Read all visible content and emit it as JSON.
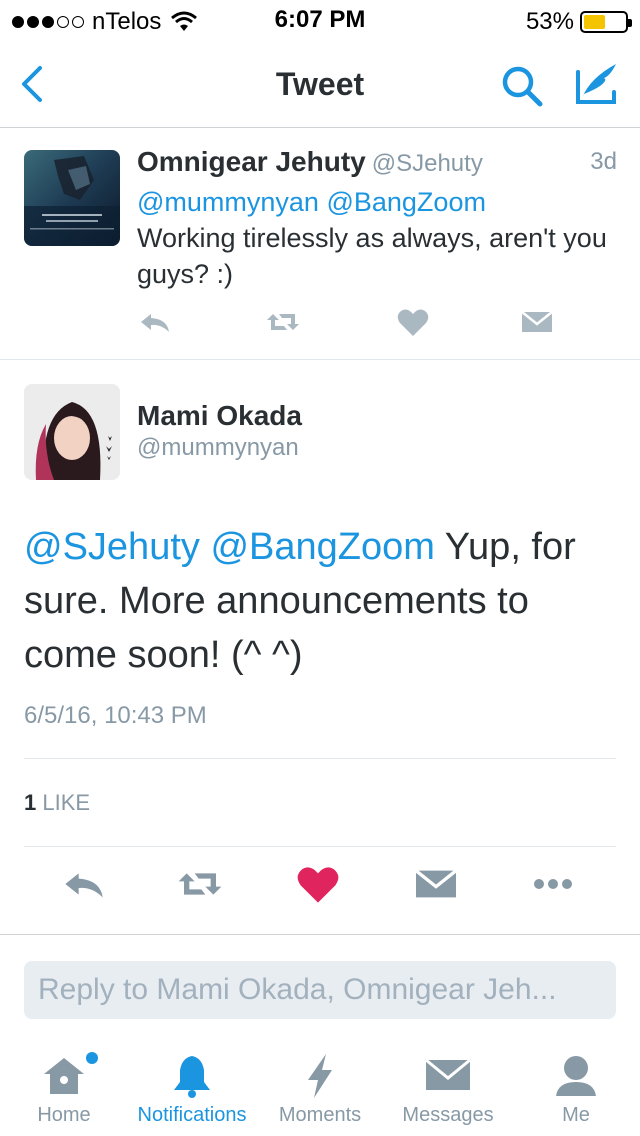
{
  "status_bar": {
    "carrier": "nTelos",
    "time": "6:07 PM",
    "battery": "53%",
    "battery_level": 0.53
  },
  "nav": {
    "title": "Tweet"
  },
  "parent_tweet": {
    "name": "Omnigear Jehuty",
    "handle": "@SJehuty",
    "time": "3d",
    "mention_1": "@mummynyan",
    "mention_2": "@BangZoom",
    "text": "Working tirelessly as always, aren't you guys?  :)"
  },
  "main_tweet": {
    "name": "Mami Okada",
    "handle": "@mummynyan",
    "mention_1": "@SJehuty",
    "mention_2": "@BangZoom",
    "text": "Yup, for sure.  More announcements to come soon! (^ ^)",
    "date": "6/5/16, 10:43 PM",
    "like_count": "1",
    "like_label": "LIKE"
  },
  "reply": {
    "placeholder": "Reply to Mami Okada, Omnigear Jeh..."
  },
  "tabs": [
    {
      "label": "Home",
      "icon": "home-icon"
    },
    {
      "label": "Notifications",
      "icon": "bell-icon"
    },
    {
      "label": "Moments",
      "icon": "lightning-icon"
    },
    {
      "label": "Messages",
      "icon": "envelope-icon"
    },
    {
      "label": "Me",
      "icon": "person-icon"
    }
  ],
  "colors": {
    "accent": "#1b95e0",
    "text": "#292f33",
    "muted": "#8899a6",
    "like": "#e0245e"
  }
}
